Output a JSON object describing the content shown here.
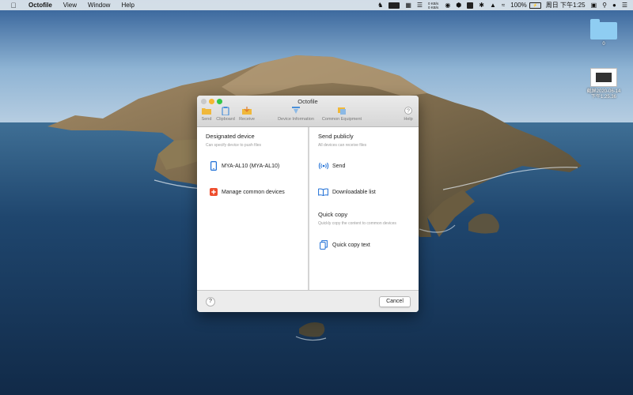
{
  "menubar": {
    "app_name": "Octofile",
    "menus": [
      "View",
      "Window",
      "Help"
    ],
    "status": {
      "net_up": "0 KB/s",
      "net_down": "0 KB/s",
      "battery_percent": "100%",
      "datetime": "周日 下午1:25"
    }
  },
  "desktop": {
    "folder_label": "0",
    "screenshot_label_line1": "截屏2020-06-14",
    "screenshot_label_line2": "下午1.25.36"
  },
  "window": {
    "title": "Octofile",
    "toolbar": {
      "send": "Send",
      "clipboard": "Clipboard",
      "receive": "Receive",
      "device_information": "Device Information",
      "common_equipment": "Common Equipment",
      "help": "Help"
    },
    "left": {
      "title": "Designated device",
      "subtitle": "Can specify device to push files",
      "device_name": "MYA-AL10 (MYA-AL10)",
      "manage": "Manage common devices"
    },
    "right": {
      "send_title": "Send publicly",
      "send_subtitle": "All devices can receive files",
      "send_action": "Send",
      "download_action": "Downloadable list",
      "quick_title": "Quick copy",
      "quick_subtitle": "Quickly copy the content to common devices",
      "quick_action": "Quick copy text"
    },
    "footer": {
      "help_symbol": "?",
      "cancel": "Cancel"
    }
  },
  "colors": {
    "accent_blue": "#1f6fd6",
    "manage_red": "#ee4d2d",
    "green_max": "#33c748",
    "yellow_min": "#f5b730"
  }
}
